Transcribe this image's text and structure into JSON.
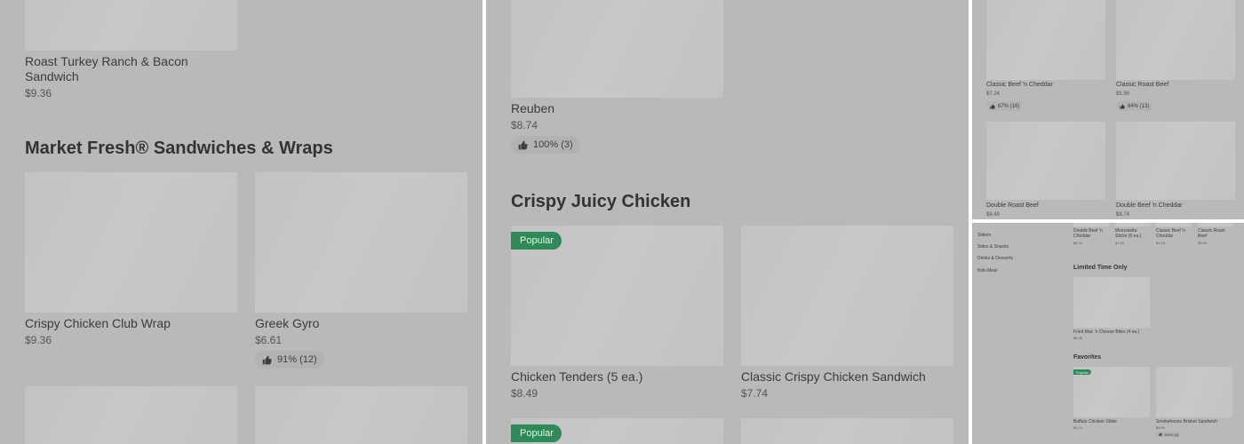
{
  "panel1": {
    "item_top": {
      "name_line1": "Roast Turkey Ranch & Bacon",
      "name_line2": "Sandwich",
      "price": "$9.36"
    },
    "section_heading": "Market Fresh® Sandwiches & Wraps",
    "items": [
      {
        "name": "Crispy Chicken Club Wrap",
        "price": "$9.36"
      },
      {
        "name": "Greek Gyro",
        "price": "$6.61",
        "rating": "91% (12)"
      }
    ]
  },
  "panel2": {
    "item_top": {
      "name": "Reuben",
      "price": "$8.74",
      "rating": "100% (3)"
    },
    "section_heading": "Crispy Juicy Chicken",
    "items": [
      {
        "name": "Chicken Tenders (5 ea.)",
        "price": "$8.49",
        "badge": "Popular"
      },
      {
        "name": "Classic Crispy Chicken Sandwich",
        "price": "$7.74"
      }
    ],
    "next_badge": "Popular"
  },
  "panel3": {
    "items": [
      {
        "name": "Classic Beef 'n Cheddar",
        "price": "$7.24",
        "rating": "87% (16)"
      },
      {
        "name": "Classic Roast Beef",
        "price": "$5.99",
        "rating": "84% (13)"
      },
      {
        "name": "Double Roast Beef",
        "price": "$8.49"
      },
      {
        "name": "Double Beef 'n Cheddar",
        "price": "$8.74"
      }
    ]
  },
  "panel4": {
    "sidebar": [
      "Sliders",
      "Sides & Snacks",
      "Drinks & Desserts",
      "Kids Meal"
    ],
    "top_items": [
      {
        "name_line1": "Double Beef 'n",
        "name_line2": "Cheddar",
        "price": "$8.74"
      },
      {
        "name_line1": "Mozzarella",
        "name_line2": "Sticks (6 ea.)",
        "price": "$7.49"
      },
      {
        "name_line1": "Classic Beef 'n",
        "name_line2": "Cheddar",
        "price": "$7.24"
      },
      {
        "name_line1": "Classic Roast",
        "name_line2": "Beef",
        "price": "$5.99"
      }
    ],
    "limited_heading": "Limited Time Only",
    "limited_item": {
      "name": "Fried Mac 'n Cheese Bites (4 ea.)",
      "price": "$5.36"
    },
    "favorites_heading": "Favorites",
    "favorites": [
      {
        "name": "Buffalo Chicken Slider",
        "price": "$2.74",
        "badge": "Popular"
      },
      {
        "name": "Smokehouse Brisket Sandwich",
        "price": "$9.99",
        "rating": "100% (3)"
      }
    ]
  },
  "colors": {
    "overlay": "#b9b9b9",
    "image_placeholder": "#c5c5c5",
    "badge_green": "#2f8a5a",
    "divider": "#ffffff"
  },
  "icons": {
    "rating": "thumbs-up-icon"
  }
}
